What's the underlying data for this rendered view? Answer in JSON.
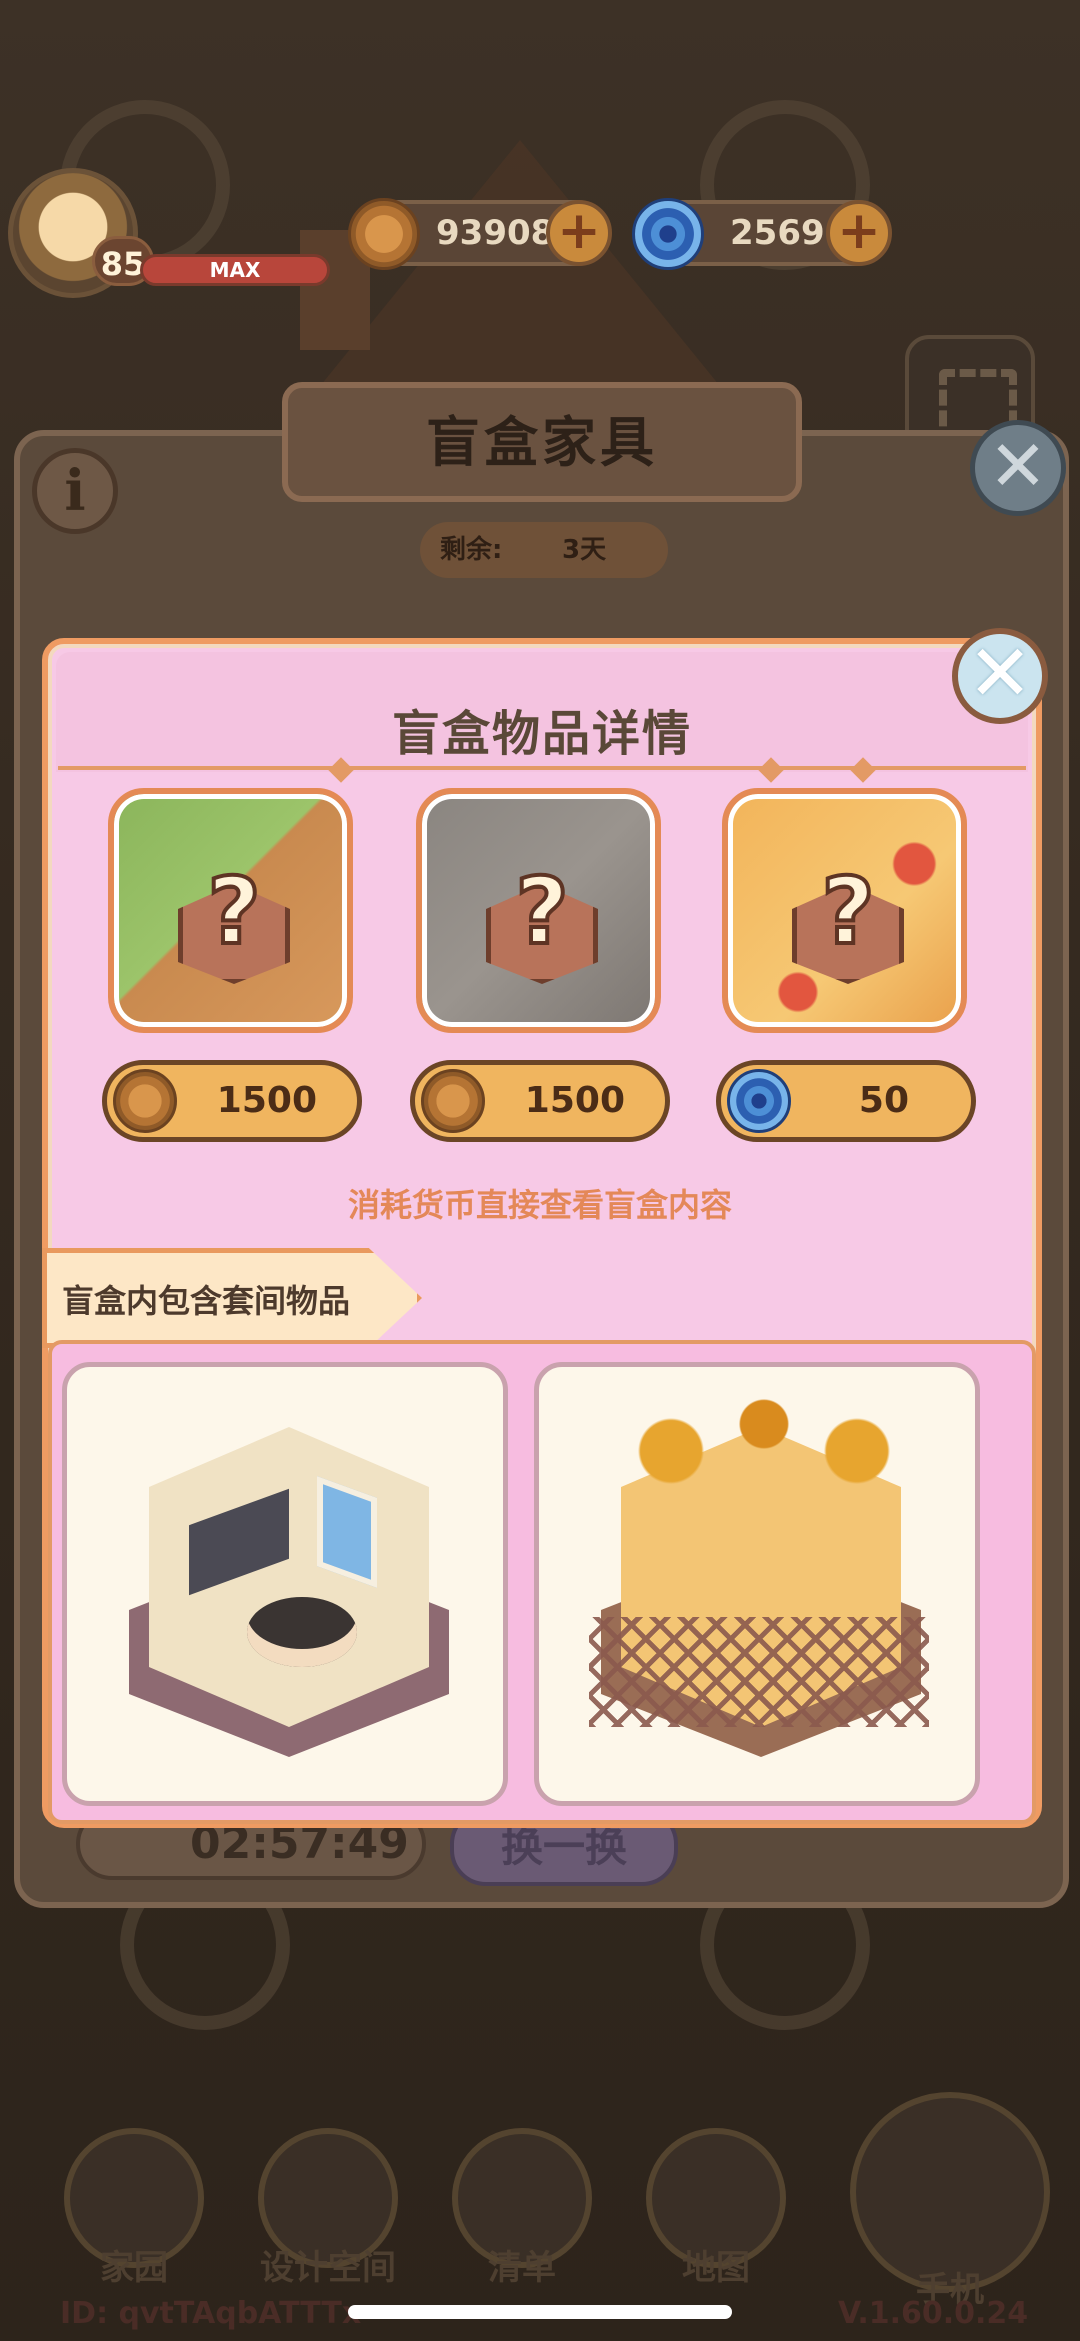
{
  "hud": {
    "level": "85",
    "xp_label": "MAX",
    "coins": "93908",
    "gems": "2569",
    "plus_symbol": "+"
  },
  "back_panel": {
    "title": "盲盒家具",
    "remaining_label": "剩余:",
    "remaining_value": "3天",
    "info_symbol": "i",
    "timer": "02:57:49",
    "swap_button": "换一换"
  },
  "modal": {
    "title": "盲盒物品详情",
    "close_symbol": "✕",
    "mystery_symbol": "?",
    "boxes": [
      {
        "price": "1500",
        "currency": "coin"
      },
      {
        "price": "1500",
        "currency": "coin"
      },
      {
        "price": "50",
        "currency": "gem"
      }
    ],
    "hint": "消耗货币直接查看盲盒内容",
    "section_label": "盲盒内包含套间物品",
    "items": [
      "living-room-suite",
      "autumn-greenhouse-suite"
    ]
  },
  "nav": {
    "items": [
      "家园",
      "设计空间",
      "清单",
      "地图"
    ],
    "phone": "手机"
  },
  "footer": {
    "id_text": "ID: qvtTAqbATTTx",
    "version": "V.1.60.0.24"
  },
  "colors": {
    "modal_bg": "#f7c9e6",
    "modal_border": "#ef9b62",
    "price_pill": "#f0b55f",
    "hint_text": "#e48858"
  }
}
